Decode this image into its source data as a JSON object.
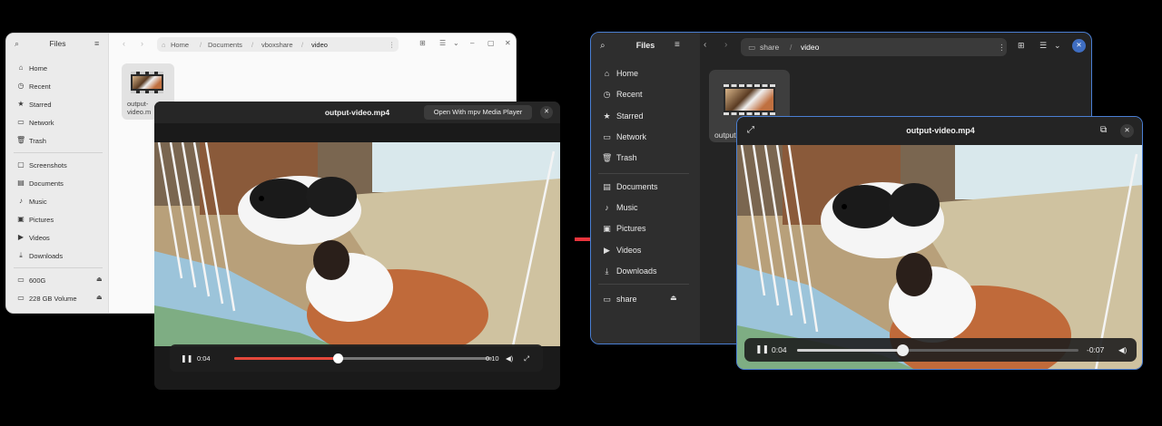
{
  "left": {
    "files": {
      "title": "Files",
      "sidebar": [
        {
          "label": "Home",
          "icon": "home-icon",
          "glyph": "⌂"
        },
        {
          "label": "Recent",
          "icon": "clock-icon",
          "glyph": "◷"
        },
        {
          "label": "Starred",
          "icon": "star-icon",
          "glyph": "★"
        },
        {
          "label": "Network",
          "icon": "network-icon",
          "glyph": "▭"
        },
        {
          "label": "Trash",
          "icon": "trash-icon",
          "glyph": "🗑"
        },
        {
          "label": "Screenshots",
          "icon": "folder-icon",
          "glyph": "▢"
        },
        {
          "label": "Documents",
          "icon": "document-icon",
          "glyph": "▤"
        },
        {
          "label": "Music",
          "icon": "music-icon",
          "glyph": "♪"
        },
        {
          "label": "Pictures",
          "icon": "picture-icon",
          "glyph": "▣"
        },
        {
          "label": "Videos",
          "icon": "video-icon",
          "glyph": "▶"
        },
        {
          "label": "Downloads",
          "icon": "download-icon",
          "glyph": "⤓"
        },
        {
          "label": "600G",
          "icon": "drive-icon",
          "glyph": "▭"
        },
        {
          "label": "228 GB Volume",
          "icon": "drive-icon",
          "glyph": "▭"
        }
      ],
      "eject": "⏏",
      "path": [
        "Home",
        "Documents",
        "vboxshare",
        "video"
      ],
      "file_label_1": "output-",
      "file_label_2": "video.m"
    },
    "player": {
      "title": "output-video.mp4",
      "open_with": "Open With mpv Media Player",
      "close": "✕",
      "time_current": "0:04",
      "time_total": "0:10",
      "progress": 0.4
    }
  },
  "right": {
    "files": {
      "title": "Files",
      "sidebar": [
        {
          "label": "Home",
          "icon": "home-icon",
          "glyph": "⌂"
        },
        {
          "label": "Recent",
          "icon": "clock-icon",
          "glyph": "◷"
        },
        {
          "label": "Starred",
          "icon": "star-icon",
          "glyph": "★"
        },
        {
          "label": "Network",
          "icon": "network-icon",
          "glyph": "▭"
        },
        {
          "label": "Trash",
          "icon": "trash-icon",
          "glyph": "🗑"
        },
        {
          "label": "Documents",
          "icon": "document-icon",
          "glyph": "▤"
        },
        {
          "label": "Music",
          "icon": "music-icon",
          "glyph": "♪"
        },
        {
          "label": "Pictures",
          "icon": "picture-icon",
          "glyph": "▣"
        },
        {
          "label": "Videos",
          "icon": "video-icon",
          "glyph": "▶"
        },
        {
          "label": "Downloads",
          "icon": "download-icon",
          "glyph": "⤓"
        },
        {
          "label": "share",
          "icon": "drive-icon",
          "glyph": "▭"
        }
      ],
      "eject": "⏏",
      "path": [
        "share",
        "video"
      ],
      "file_label": "output"
    },
    "player": {
      "title": "output-video.mp4",
      "close": "✕",
      "time_current": "0:04",
      "time_remaining": "-0:07",
      "progress": 0.375
    }
  },
  "colors": {
    "arrow": "#e8343c",
    "left_progress": "#e5483b",
    "right_accent": "#4a7fd4"
  }
}
